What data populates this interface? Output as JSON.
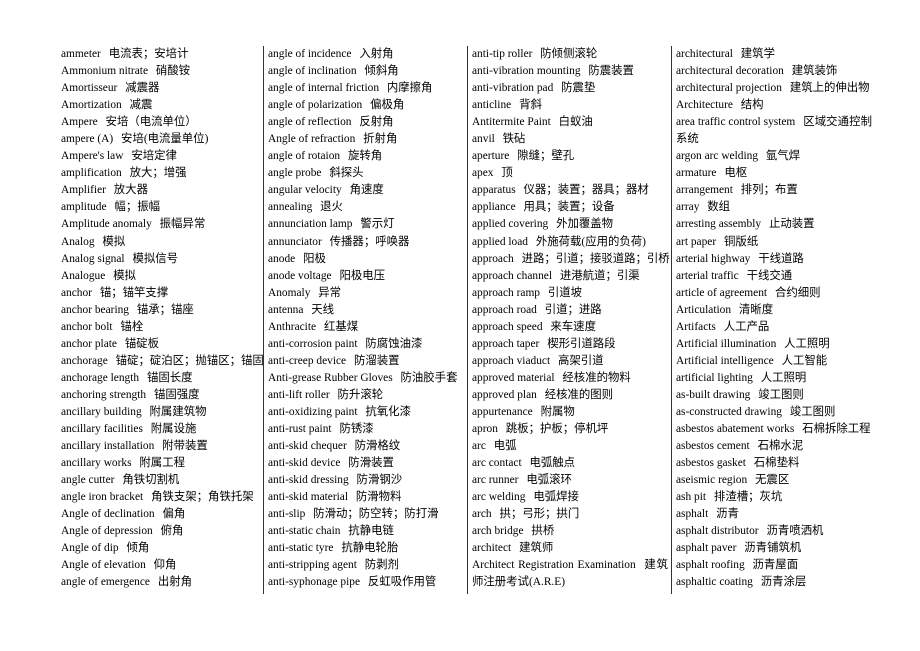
{
  "columns": [
    [
      {
        "term": "ammeter",
        "translation": "电流表；安培计"
      },
      {
        "term": "Ammonium nitrate",
        "translation": "硝酸铵"
      },
      {
        "term": "Amortisseur",
        "translation": "减震器"
      },
      {
        "term": "Amortization",
        "translation": "减震"
      },
      {
        "term": "Ampere",
        "translation": "安培（电流单位）"
      },
      {
        "term": "ampere (A)",
        "translation": "安培(电流量单位)"
      },
      {
        "term": "Ampere's law",
        "translation": "安培定律"
      },
      {
        "term": "amplification",
        "translation": "放大；增强"
      },
      {
        "term": "Amplifier",
        "translation": "放大器"
      },
      {
        "term": "amplitude",
        "translation": "幅；振幅"
      },
      {
        "term": "Amplitude anomaly",
        "translation": "振幅异常"
      },
      {
        "term": "Analog",
        "translation": "模拟"
      },
      {
        "term": "Analog signal",
        "translation": "模拟信号"
      },
      {
        "term": "Analogue",
        "translation": "模拟"
      },
      {
        "term": "anchor",
        "translation": "锚；锚竿支撑"
      },
      {
        "term": "anchor bearing",
        "translation": "锚承；锚座"
      },
      {
        "term": "anchor bolt",
        "translation": "锚栓"
      },
      {
        "term": "anchor plate",
        "translation": "锚碇板"
      },
      {
        "term": "anchorage",
        "translation": "锚碇；碇泊区；抛锚区；锚固"
      },
      {
        "term": "anchorage length",
        "translation": "锚固长度"
      },
      {
        "term": "anchoring strength",
        "translation": "锚固强度"
      },
      {
        "term": "ancillary building",
        "translation": "附属建筑物"
      },
      {
        "term": "ancillary facilities",
        "translation": "附属设施"
      },
      {
        "term": "ancillary installation",
        "translation": "附带装置"
      },
      {
        "term": "ancillary works",
        "translation": "附属工程"
      },
      {
        "term": "angle cutter",
        "translation": "角铁切割机"
      },
      {
        "term": "angle iron bracket",
        "translation": "角铁支架；角铁托架"
      },
      {
        "term": "Angle of declination",
        "translation": "偏角"
      },
      {
        "term": "Angle of depression",
        "translation": "俯角"
      },
      {
        "term": "Angle of dip",
        "translation": "倾角"
      },
      {
        "term": "Angle of elevation",
        "translation": "仰角"
      },
      {
        "term": "angle of emergence",
        "translation": "出射角"
      }
    ],
    [
      {
        "term": "angle of incidence",
        "translation": "入射角"
      },
      {
        "term": "angle of inclination",
        "translation": "倾斜角"
      },
      {
        "term": "angle of internal friction",
        "translation": "内摩擦角"
      },
      {
        "term": "angle of polarization",
        "translation": "偏极角"
      },
      {
        "term": "angle of reflection",
        "translation": "反射角"
      },
      {
        "term": "Angle of refraction",
        "translation": "折射角"
      },
      {
        "term": "angle of rotaion",
        "translation": "旋转角"
      },
      {
        "term": "angle probe",
        "translation": "斜探头"
      },
      {
        "term": "angular velocity",
        "translation": "角速度"
      },
      {
        "term": "annealing",
        "translation": "退火"
      },
      {
        "term": "annunciation lamp",
        "translation": "警示灯"
      },
      {
        "term": "annunciator",
        "translation": "传播器；呼唤器"
      },
      {
        "term": "anode",
        "translation": "阳极"
      },
      {
        "term": "anode voltage",
        "translation": "阳极电压"
      },
      {
        "term": "Anomaly",
        "translation": "异常"
      },
      {
        "term": "antenna",
        "translation": "天线"
      },
      {
        "term": "Anthracite",
        "translation": "红基煤"
      },
      {
        "term": "anti-corrosion paint",
        "translation": "防腐蚀油漆"
      },
      {
        "term": "anti-creep device",
        "translation": "防溜装置"
      },
      {
        "term": "Anti-grease Rubber Gloves",
        "translation": "防油胶手套"
      },
      {
        "term": "anti-lift roller",
        "translation": "防升滚轮"
      },
      {
        "term": "anti-oxidizing paint",
        "translation": "抗氧化漆"
      },
      {
        "term": "anti-rust paint",
        "translation": "防锈漆"
      },
      {
        "term": "anti-skid chequer",
        "translation": "防滑格纹"
      },
      {
        "term": "anti-skid device",
        "translation": "防滑装置"
      },
      {
        "term": "anti-skid dressing",
        "translation": "防滑钢沙"
      },
      {
        "term": "anti-skid material",
        "translation": "防滑物料"
      },
      {
        "term": "anti-slip",
        "translation": "防滑动；防空转；防打滑"
      },
      {
        "term": "anti-static chain",
        "translation": "抗静电链"
      },
      {
        "term": "anti-static tyre",
        "translation": "抗静电轮胎"
      },
      {
        "term": "anti-stripping agent",
        "translation": "防剥剂"
      },
      {
        "term": "anti-syphonage pipe",
        "translation": "反虹吸作用管"
      }
    ],
    [
      {
        "term": "anti-tip roller",
        "translation": "防倾侧滚轮"
      },
      {
        "term": "anti-vibration mounting",
        "translation": "防震装置"
      },
      {
        "term": "anti-vibration pad",
        "translation": "防震垫"
      },
      {
        "term": "anticline",
        "translation": "背斜"
      },
      {
        "term": "Antitermite Paint",
        "translation": "白蚁油"
      },
      {
        "term": "anvil",
        "translation": "铁砧"
      },
      {
        "term": "aperture",
        "translation": "隙缝；壁孔"
      },
      {
        "term": "apex",
        "translation": "顶"
      },
      {
        "term": "apparatus",
        "translation": "仪器；装置；器具；器材"
      },
      {
        "term": "appliance",
        "translation": "用具；装置；设备"
      },
      {
        "term": "applied covering",
        "translation": "外加覆盖物"
      },
      {
        "term": "applied load",
        "translation": "外施荷载(应用的负荷)"
      },
      {
        "term": "approach",
        "translation": "进路；引道；接驳道路；引桥"
      },
      {
        "term": "approach channel",
        "translation": "进港航道；引渠"
      },
      {
        "term": "approach ramp",
        "translation": "引道坡"
      },
      {
        "term": "approach road",
        "translation": "引道；进路"
      },
      {
        "term": "approach speed",
        "translation": "来车速度"
      },
      {
        "term": "approach taper",
        "translation": "楔形引道路段"
      },
      {
        "term": "approach viaduct",
        "translation": "高架引道"
      },
      {
        "term": "approved material",
        "translation": "经核准的物料"
      },
      {
        "term": "approved plan",
        "translation": "经核准的图则"
      },
      {
        "term": "appurtenance",
        "translation": "附属物"
      },
      {
        "term": "apron",
        "translation": "跳板；护板；停机坪"
      },
      {
        "term": "arc",
        "translation": "电弧"
      },
      {
        "term": "arc contact",
        "translation": "电弧触点"
      },
      {
        "term": "arc runner",
        "translation": "电弧滚环"
      },
      {
        "term": "arc welding",
        "translation": "电弧焊接"
      },
      {
        "term": "arch",
        "translation": "拱；弓形；拱门"
      },
      {
        "term": "arch bridge",
        "translation": "拱桥"
      },
      {
        "term": "architect",
        "translation": "建筑师"
      },
      {
        "term": "Architect Registration Examination",
        "translation": "建筑师注册考试(A.R.E)",
        "wrap": true
      }
    ],
    [
      {
        "term": "architectural",
        "translation": "建筑学"
      },
      {
        "term": "architectural decoration",
        "translation": "建筑装饰"
      },
      {
        "term": "architectural projection",
        "translation": "建筑上的伸出物"
      },
      {
        "term": "Architecture",
        "translation": "结构"
      },
      {
        "term": "area traffic control system",
        "translation": "区域交通控制系统",
        "wrap": true
      },
      {
        "term": "argon arc welding",
        "translation": "氩气焊"
      },
      {
        "term": "armature",
        "translation": "电枢"
      },
      {
        "term": "arrangement",
        "translation": "排列；布置"
      },
      {
        "term": "array",
        "translation": "数组"
      },
      {
        "term": "arresting assembly",
        "translation": "止动装置"
      },
      {
        "term": "art paper",
        "translation": "铜版纸"
      },
      {
        "term": "arterial highway",
        "translation": "干线道路"
      },
      {
        "term": "arterial traffic",
        "translation": "干线交通"
      },
      {
        "term": "article of agreement",
        "translation": "合约细则"
      },
      {
        "term": "Articulation",
        "translation": "清晰度"
      },
      {
        "term": "Artifacts",
        "translation": "人工产品"
      },
      {
        "term": "Artificial illumination",
        "translation": "人工照明"
      },
      {
        "term": "Artificial intelligence",
        "translation": "人工智能"
      },
      {
        "term": "artificial lighting",
        "translation": "人工照明"
      },
      {
        "term": "as-built drawing",
        "translation": "竣工图则"
      },
      {
        "term": "as-constructed drawing",
        "translation": "竣工图则"
      },
      {
        "term": "asbestos abatement works",
        "translation": "石棉拆除工程"
      },
      {
        "term": "asbestos cement",
        "translation": "石棉水泥"
      },
      {
        "term": "asbestos gasket",
        "translation": "石棉垫料"
      },
      {
        "term": "aseismic region",
        "translation": "无震区"
      },
      {
        "term": "ash pit",
        "translation": "排渣槽；灰坑"
      },
      {
        "term": "asphalt",
        "translation": "沥青"
      },
      {
        "term": "asphalt distributor",
        "translation": "沥青喷洒机"
      },
      {
        "term": "asphalt paver",
        "translation": "沥青铺筑机"
      },
      {
        "term": "asphalt roofing",
        "translation": "沥青屋面"
      },
      {
        "term": "asphaltic coating",
        "translation": "沥青涂层"
      }
    ]
  ]
}
